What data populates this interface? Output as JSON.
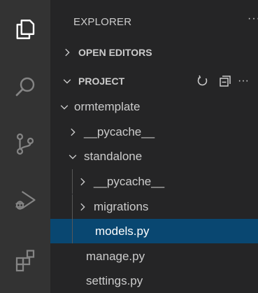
{
  "explorer": {
    "title": "EXPLORER",
    "more_label": "···",
    "sections": {
      "open_editors": "OPEN EDITORS",
      "project": "PROJECT",
      "project_more": "···"
    },
    "tree": {
      "root": "ormtemplate",
      "root_pycache": "__pycache__",
      "standalone": "standalone",
      "standalone_pycache": "__pycache__",
      "migrations": "migrations",
      "models": "models.py",
      "manage": "manage.py",
      "settings": "settings.py"
    }
  },
  "activity_bar": {
    "icons": [
      "files-icon",
      "search-icon",
      "source-control-icon",
      "run-debug-icon",
      "extensions-icon"
    ]
  },
  "colors": {
    "activity_bar_bg": "#333333",
    "sidebar_bg": "#252526",
    "selection_bg": "#094771",
    "text": "#cccccc",
    "active_icon": "#ffffff"
  }
}
